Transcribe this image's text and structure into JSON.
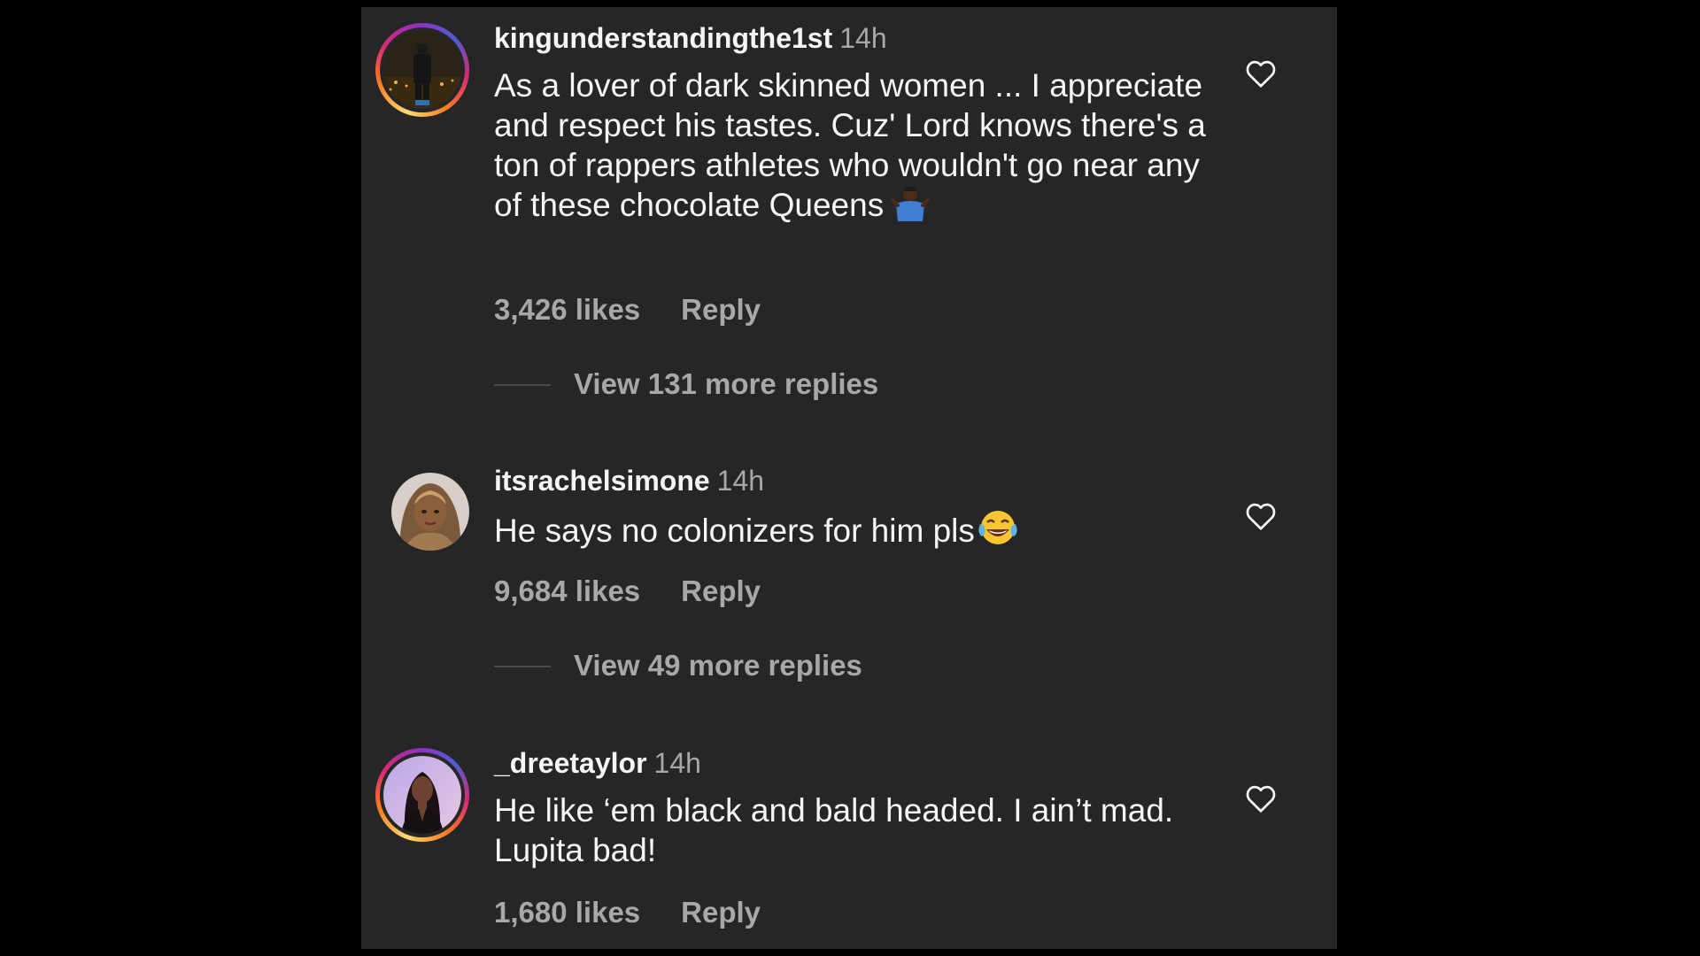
{
  "comments": [
    {
      "username": "kingunderstandingthe1st",
      "time": "14h",
      "text": "As a lover of dark skinned women ... I appreciate and respect his tastes. Cuz' Lord knows there's a ton of rappers athletes who wouldn't go near any of these chocolate Queens",
      "emoji": "person-shrugging-emoji",
      "likes": "3,426 likes",
      "reply_label": "Reply",
      "view_replies": "View 131 more replies",
      "story_ring": true
    },
    {
      "username": "itsrachelsimone",
      "time": "14h",
      "text": "He says no colonizers for him pls",
      "emoji": "tears-of-joy-emoji",
      "likes": "9,684 likes",
      "reply_label": "Reply",
      "view_replies": "View 49 more replies",
      "story_ring": false
    },
    {
      "username": "_dreetaylor",
      "time": "14h",
      "text": "He like ‘em black and bald headed. I ain’t mad. Lupita bad!",
      "likes": "1,680 likes",
      "reply_label": "Reply",
      "story_ring": true
    }
  ],
  "icons": {
    "like": "heart-outline-icon"
  },
  "colors": {
    "background": "#262626",
    "outer": "#000000",
    "primary_text": "#f5f5f5",
    "secondary_text": "#a8a8a8"
  }
}
